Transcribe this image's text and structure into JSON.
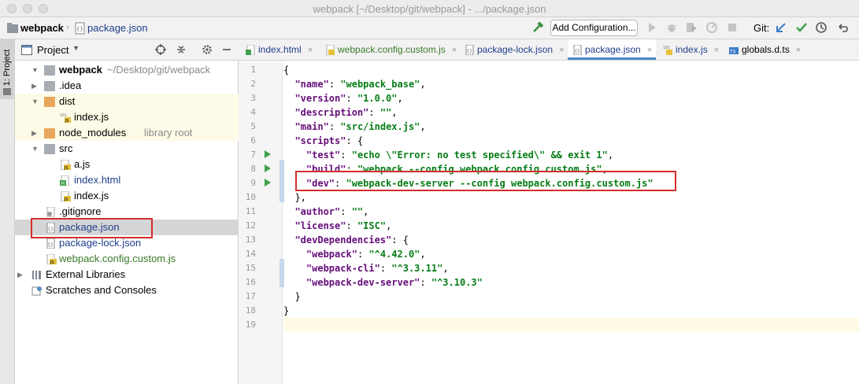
{
  "window": {
    "title": "webpack [~/Desktop/git/webpack] - .../package.json"
  },
  "navbar": {
    "crumb_project": "webpack",
    "crumb_file": "package.json",
    "add_config_label": "Add Configuration...",
    "git_label": "Git:"
  },
  "sidebar_stripe": {
    "label": "1: Project"
  },
  "project_panel": {
    "header_label": "Project",
    "tree": [
      {
        "label": "webpack",
        "suffix": "~/Desktop/git/webpack"
      },
      {
        "label": ".idea"
      },
      {
        "label": "dist"
      },
      {
        "label": "index.js"
      },
      {
        "label": "node_modules",
        "suffix": "library root"
      },
      {
        "label": "src"
      },
      {
        "label": "a.js"
      },
      {
        "label": "index.html"
      },
      {
        "label": "index.js"
      },
      {
        "label": ".gitignore"
      },
      {
        "label": "package.json"
      },
      {
        "label": "package-lock.json"
      },
      {
        "label": "webpack.config.custom.js"
      },
      {
        "label": "External Libraries"
      },
      {
        "label": "Scratches and Consoles"
      }
    ]
  },
  "editor": {
    "tabs": [
      {
        "label": "index.html",
        "icon": "H"
      },
      {
        "label": "webpack.config.custom.js",
        "icon": "JS"
      },
      {
        "label": "package-lock.json",
        "icon": "{}"
      },
      {
        "label": "package.json",
        "icon": "{}"
      },
      {
        "label": "index.js",
        "icon": "JS"
      },
      {
        "label": "globals.d.ts",
        "icon": "TS"
      }
    ],
    "active_tab": "package.json",
    "line_numbers": [
      "1",
      "2",
      "3",
      "4",
      "5",
      "6",
      "7",
      "8",
      "9",
      "10",
      "11",
      "12",
      "13",
      "14",
      "15",
      "16",
      "17",
      "18",
      "19"
    ],
    "lines": [
      [
        {
          "t": "{",
          "c": "pn"
        }
      ],
      [
        {
          "t": "  ",
          "c": "pn"
        },
        {
          "t": "\"name\"",
          "c": "key"
        },
        {
          "t": ": ",
          "c": "pn"
        },
        {
          "t": "\"webpack_base\"",
          "c": "str"
        },
        {
          "t": ",",
          "c": "pn"
        }
      ],
      [
        {
          "t": "  ",
          "c": "pn"
        },
        {
          "t": "\"version\"",
          "c": "key"
        },
        {
          "t": ": ",
          "c": "pn"
        },
        {
          "t": "\"1.0.0\"",
          "c": "str"
        },
        {
          "t": ",",
          "c": "pn"
        }
      ],
      [
        {
          "t": "  ",
          "c": "pn"
        },
        {
          "t": "\"description\"",
          "c": "key"
        },
        {
          "t": ": ",
          "c": "pn"
        },
        {
          "t": "\"\"",
          "c": "str"
        },
        {
          "t": ",",
          "c": "pn"
        }
      ],
      [
        {
          "t": "  ",
          "c": "pn"
        },
        {
          "t": "\"main\"",
          "c": "key"
        },
        {
          "t": ": ",
          "c": "pn"
        },
        {
          "t": "\"src/index.js\"",
          "c": "str"
        },
        {
          "t": ",",
          "c": "pn"
        }
      ],
      [
        {
          "t": "  ",
          "c": "pn"
        },
        {
          "t": "\"scripts\"",
          "c": "key"
        },
        {
          "t": ": {",
          "c": "pn"
        }
      ],
      [
        {
          "t": "    ",
          "c": "pn"
        },
        {
          "t": "\"test\"",
          "c": "key"
        },
        {
          "t": ": ",
          "c": "pn"
        },
        {
          "t": "\"echo \\\"Error: no test specified\\\" && exit 1\"",
          "c": "str"
        },
        {
          "t": ",",
          "c": "pn"
        }
      ],
      [
        {
          "t": "    ",
          "c": "pn"
        },
        {
          "t": "\"build\"",
          "c": "key"
        },
        {
          "t": ": ",
          "c": "pn"
        },
        {
          "t": "\"webpack --config webpack.config.custom.js\"",
          "c": "str"
        },
        {
          "t": ",",
          "c": "pn"
        }
      ],
      [
        {
          "t": "    ",
          "c": "pn"
        },
        {
          "t": "\"dev\"",
          "c": "key"
        },
        {
          "t": ": ",
          "c": "pn"
        },
        {
          "t": "\"webpack-dev-server --config webpack.config.custom.js\"",
          "c": "str"
        }
      ],
      [
        {
          "t": "  },",
          "c": "pn"
        }
      ],
      [
        {
          "t": "  ",
          "c": "pn"
        },
        {
          "t": "\"author\"",
          "c": "key"
        },
        {
          "t": ": ",
          "c": "pn"
        },
        {
          "t": "\"\"",
          "c": "str"
        },
        {
          "t": ",",
          "c": "pn"
        }
      ],
      [
        {
          "t": "  ",
          "c": "pn"
        },
        {
          "t": "\"license\"",
          "c": "key"
        },
        {
          "t": ": ",
          "c": "pn"
        },
        {
          "t": "\"ISC\"",
          "c": "str"
        },
        {
          "t": ",",
          "c": "pn"
        }
      ],
      [
        {
          "t": "  ",
          "c": "pn"
        },
        {
          "t": "\"devDependencies\"",
          "c": "key"
        },
        {
          "t": ": {",
          "c": "pn"
        }
      ],
      [
        {
          "t": "    ",
          "c": "pn"
        },
        {
          "t": "\"webpack\"",
          "c": "key"
        },
        {
          "t": ": ",
          "c": "pn"
        },
        {
          "t": "\"^4.42.0\"",
          "c": "str"
        },
        {
          "t": ",",
          "c": "pn"
        }
      ],
      [
        {
          "t": "    ",
          "c": "pn"
        },
        {
          "t": "\"webpack-cli\"",
          "c": "key"
        },
        {
          "t": ": ",
          "c": "pn"
        },
        {
          "t": "\"^3.3.11\"",
          "c": "str"
        },
        {
          "t": ",",
          "c": "pn"
        }
      ],
      [
        {
          "t": "    ",
          "c": "pn"
        },
        {
          "t": "\"webpack-dev-server\"",
          "c": "key"
        },
        {
          "t": ": ",
          "c": "pn"
        },
        {
          "t": "\"^3.10.3\"",
          "c": "str"
        }
      ],
      [
        {
          "t": "  }",
          "c": "pn"
        }
      ],
      [
        {
          "t": "}",
          "c": "pn"
        }
      ],
      [
        {
          "t": "",
          "c": "pn"
        }
      ]
    ]
  },
  "colors": {
    "accent": "#4e88c6",
    "annotation_red": "#d42d2d",
    "json_key": "#660e7a",
    "json_string": "#067d17",
    "run_green": "#3fa14a"
  }
}
